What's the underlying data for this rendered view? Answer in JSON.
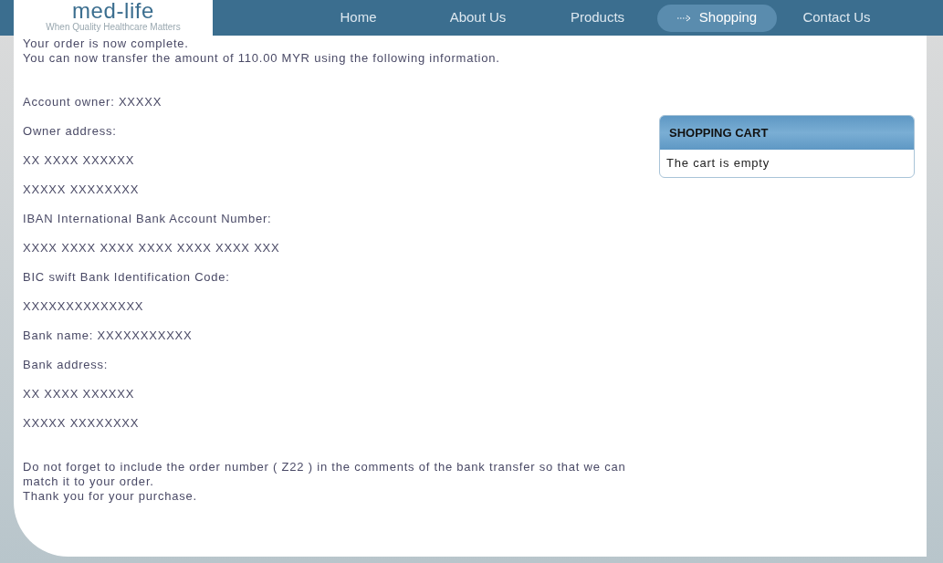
{
  "logo": {
    "name": "med-life",
    "tagline": "When Quality Healthcare Matters"
  },
  "nav": [
    {
      "label": "Home",
      "selected": false
    },
    {
      "label": "About Us",
      "selected": false
    },
    {
      "label": "Products",
      "selected": false
    },
    {
      "label": "Shopping",
      "selected": true
    },
    {
      "label": "Contact Us",
      "selected": false
    }
  ],
  "intro": [
    "Your order is now complete.",
    "You can now transfer the amount of 110.00 MYR using the following information."
  ],
  "details": [
    "Account owner: XXXXX",
    "Owner address:",
    "XX XXXX XXXXXX",
    "XXXXX XXXXXXXX",
    "IBAN International Bank Account Number:",
    "XXXX XXXX XXXX XXXX XXXX XXXX XXX",
    "BIC swift Bank Identification Code:",
    "XXXXXXXXXXXXXX",
    "Bank name: XXXXXXXXXXX",
    "Bank address:",
    "XX XXXX XXXXXX",
    "XXXXX XXXXXXXX"
  ],
  "closing": [
    "Do not forget to include the order number ( Z22 ) in the comments of the bank transfer so that we can match it to your order.",
    "Thank you for your purchase."
  ],
  "cart": {
    "title": "SHOPPING CART",
    "message": "The cart is empty"
  }
}
